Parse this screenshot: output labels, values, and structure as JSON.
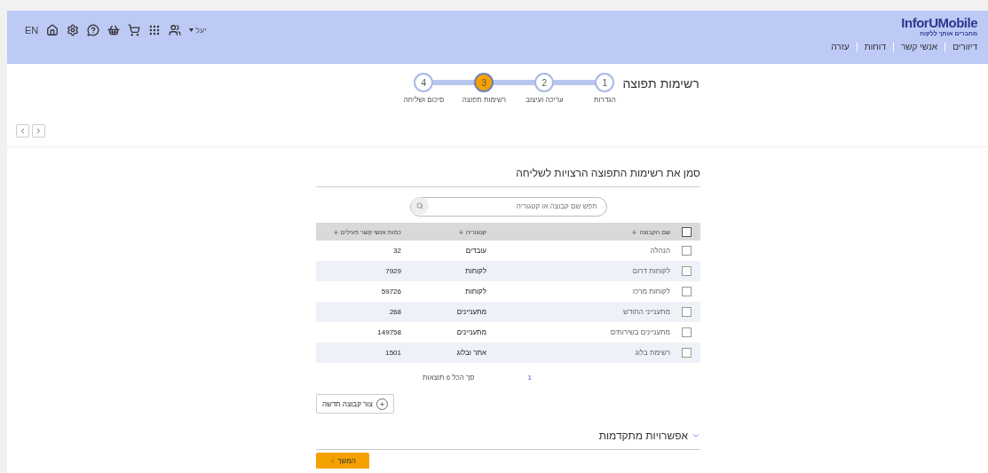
{
  "header": {
    "logo": {
      "name": "InforUMobile",
      "tagline": "מחברים אותך ללקוח"
    },
    "nav": [
      "דיוורים",
      "אנשי קשר",
      "דוחות",
      "עזרה"
    ],
    "language": "EN",
    "user": "יעל"
  },
  "wizard": {
    "title": "רשימות תפוצה",
    "steps": [
      {
        "number": "1",
        "label": "הגדרות",
        "selected": false
      },
      {
        "number": "2",
        "label": "עריכה ועיצוב",
        "selected": false
      },
      {
        "number": "3",
        "label": "רשימות תפוצה",
        "selected": true
      },
      {
        "number": "4",
        "label": "סיכום ושליחה",
        "selected": false
      }
    ]
  },
  "section_title": "סמן את רשימות התפוצה הרצויות לשליחה",
  "search": {
    "placeholder": "חפש שם קבוצה או קטגוריה"
  },
  "table": {
    "select_all_checked": false,
    "columns": [
      "שם הקבוצה",
      "קטגוריה",
      "כמות אנשי קשר פעילים"
    ],
    "rows": [
      {
        "checked": false,
        "cells": [
          "הנהלה",
          "עובדים",
          "32"
        ]
      },
      {
        "checked": false,
        "cells": [
          "לקוחות דרום",
          "לקוחות",
          "7929"
        ]
      },
      {
        "checked": false,
        "cells": [
          "לקוחות מרכז",
          "לקוחות",
          "59726"
        ]
      },
      {
        "checked": false,
        "cells": [
          "מתענייני החודש",
          "מתעניינים",
          "268"
        ]
      },
      {
        "checked": false,
        "cells": [
          "מתעניינים בשירותים",
          "מתעניינים",
          "149758"
        ]
      },
      {
        "checked": false,
        "cells": [
          "רשימת בלוג",
          "אתר ובלוג",
          "1501"
        ]
      }
    ]
  },
  "pagination": {
    "pages": [
      {
        "label": "1",
        "selected": true
      }
    ],
    "total": "סך הכל 6 תוצאות"
  },
  "create_button": "צור קבוצה חדשה",
  "advanced": {
    "label": "אפשרויות מתקדמות",
    "expanded": false
  },
  "continue_button": "המשך"
}
